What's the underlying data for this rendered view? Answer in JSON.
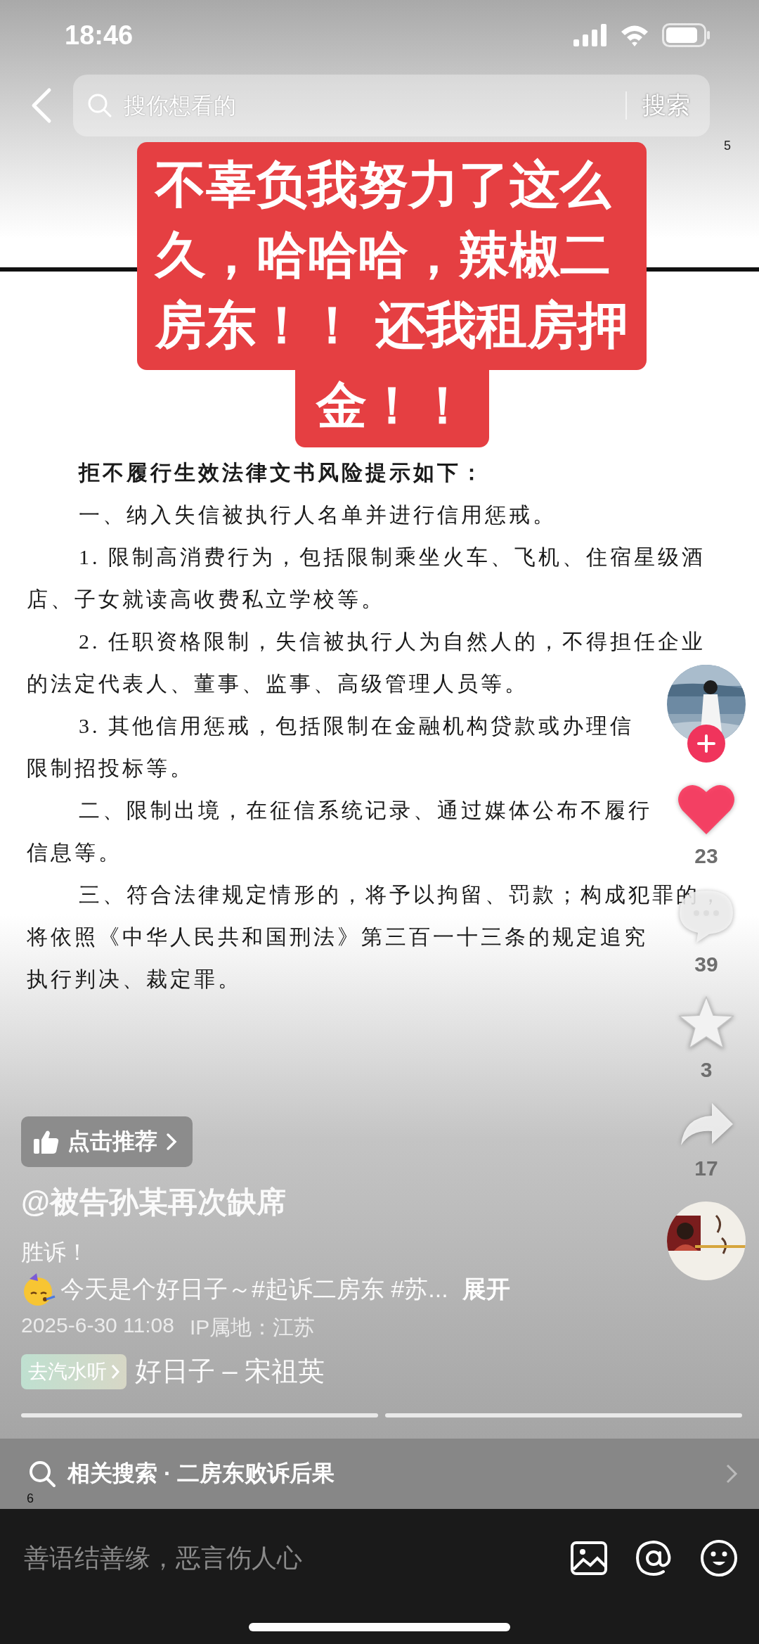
{
  "status_bar": {
    "time": "18:46"
  },
  "search_bar": {
    "placeholder": "搜你想看的",
    "button": "搜索"
  },
  "top_marker": "5",
  "caption": {
    "lines": [
      "不辜负我努力了这么",
      "久，哈哈哈，辣椒二",
      "房东！！ 还我租房押",
      "金！！"
    ]
  },
  "document": {
    "lines": [
      {
        "kind": "heading",
        "text": "拒不履行生效法律文书风险提示如下："
      },
      {
        "kind": "first",
        "text": "一、纳入失信被执行人名单并进行信用惩戒。"
      },
      {
        "kind": "first",
        "text": "1. 限制高消费行为，包括限制乘坐火车、飞机、住宿星级酒"
      },
      {
        "kind": "cont",
        "text": "店、子女就读高收费私立学校等。"
      },
      {
        "kind": "first",
        "text": "2. 任职资格限制，失信被执行人为自然人的，不得担任企业"
      },
      {
        "kind": "cont",
        "text": "的法定代表人、董事、监事、高级管理人员等。"
      },
      {
        "kind": "first",
        "text": "3. 其他信用惩戒，包括限制在金融机构贷款或办理信"
      },
      {
        "kind": "cont",
        "text": "限制招投标等。"
      },
      {
        "kind": "first",
        "text": "二、限制出境，在征信系统记录、通过媒体公布不履行"
      },
      {
        "kind": "cont",
        "text": "信息等。"
      },
      {
        "kind": "first",
        "text": "三、符合法律规定情形的，将予以拘留、罚款；构成犯罪的，"
      },
      {
        "kind": "cont",
        "text": "将依照《中华人民共和国刑法》第三百一十三条的规定追究"
      },
      {
        "kind": "cont",
        "text": "执行判决、裁定罪。"
      }
    ]
  },
  "actions": {
    "liked": true,
    "like_count": "23",
    "comment_count": "39",
    "favorited": false,
    "favorite_count": "3",
    "share_count": "17"
  },
  "post": {
    "recommend_button": "点击推荐",
    "author": "@被告孙某再次缺席",
    "text_line": "胜诉！",
    "tags_line": "今天是个好日子～#起诉二房东 #苏...",
    "expand": "展开",
    "date": "2025-6-30 11:08",
    "ip_location": "IP属地：江苏",
    "music_chip": "去汽水听",
    "song": "好日子 – 宋祖英"
  },
  "related_search": {
    "text": "相关搜索 · 二房东败诉后果"
  },
  "bottom_marker": "6",
  "comment_input": {
    "placeholder": "善语结善缘，恶言伤人心"
  }
}
